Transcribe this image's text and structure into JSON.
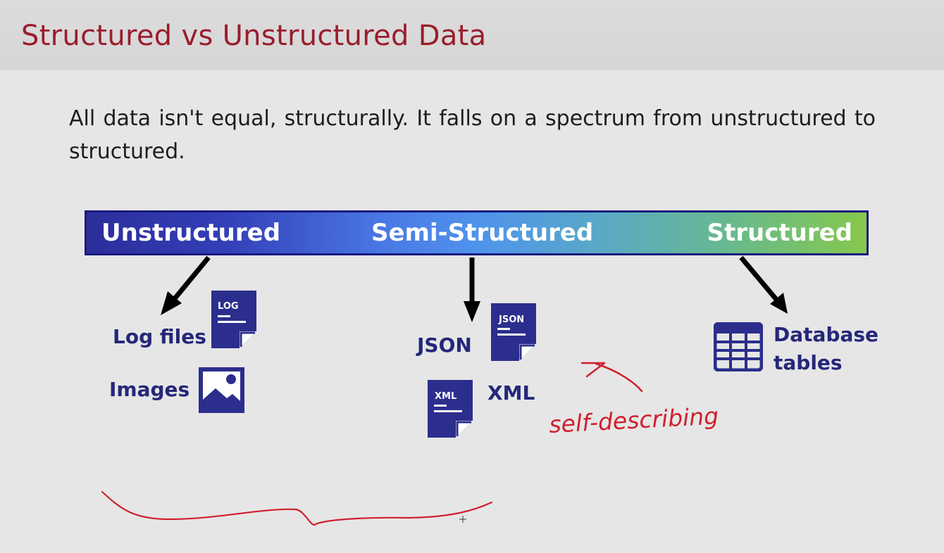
{
  "slide": {
    "title": "Structured vs Unstructured Data",
    "intro": "All data isn't equal, structurally. It falls on a spectrum from unstructured to structured."
  },
  "spectrum": {
    "left_label": "Unstructured",
    "middle_label": "Semi-Structured",
    "right_label": "Structured"
  },
  "items": {
    "log_files": "Log files",
    "images": "Images",
    "json": "JSON",
    "xml": "XML",
    "database_tables_line1": "Database",
    "database_tables_line2": "tables"
  },
  "icon_badges": {
    "log": "LOG",
    "json": "JSON",
    "xml": "XML"
  },
  "annotation": {
    "handwritten_note": "self-describing"
  },
  "colors": {
    "title": "#9b1c2c",
    "item_text": "#25277a",
    "icon": "#2b2e8c",
    "ink": "#d0202e",
    "spectrum_start": "#2c2d9a",
    "spectrum_end": "#86c84c"
  }
}
